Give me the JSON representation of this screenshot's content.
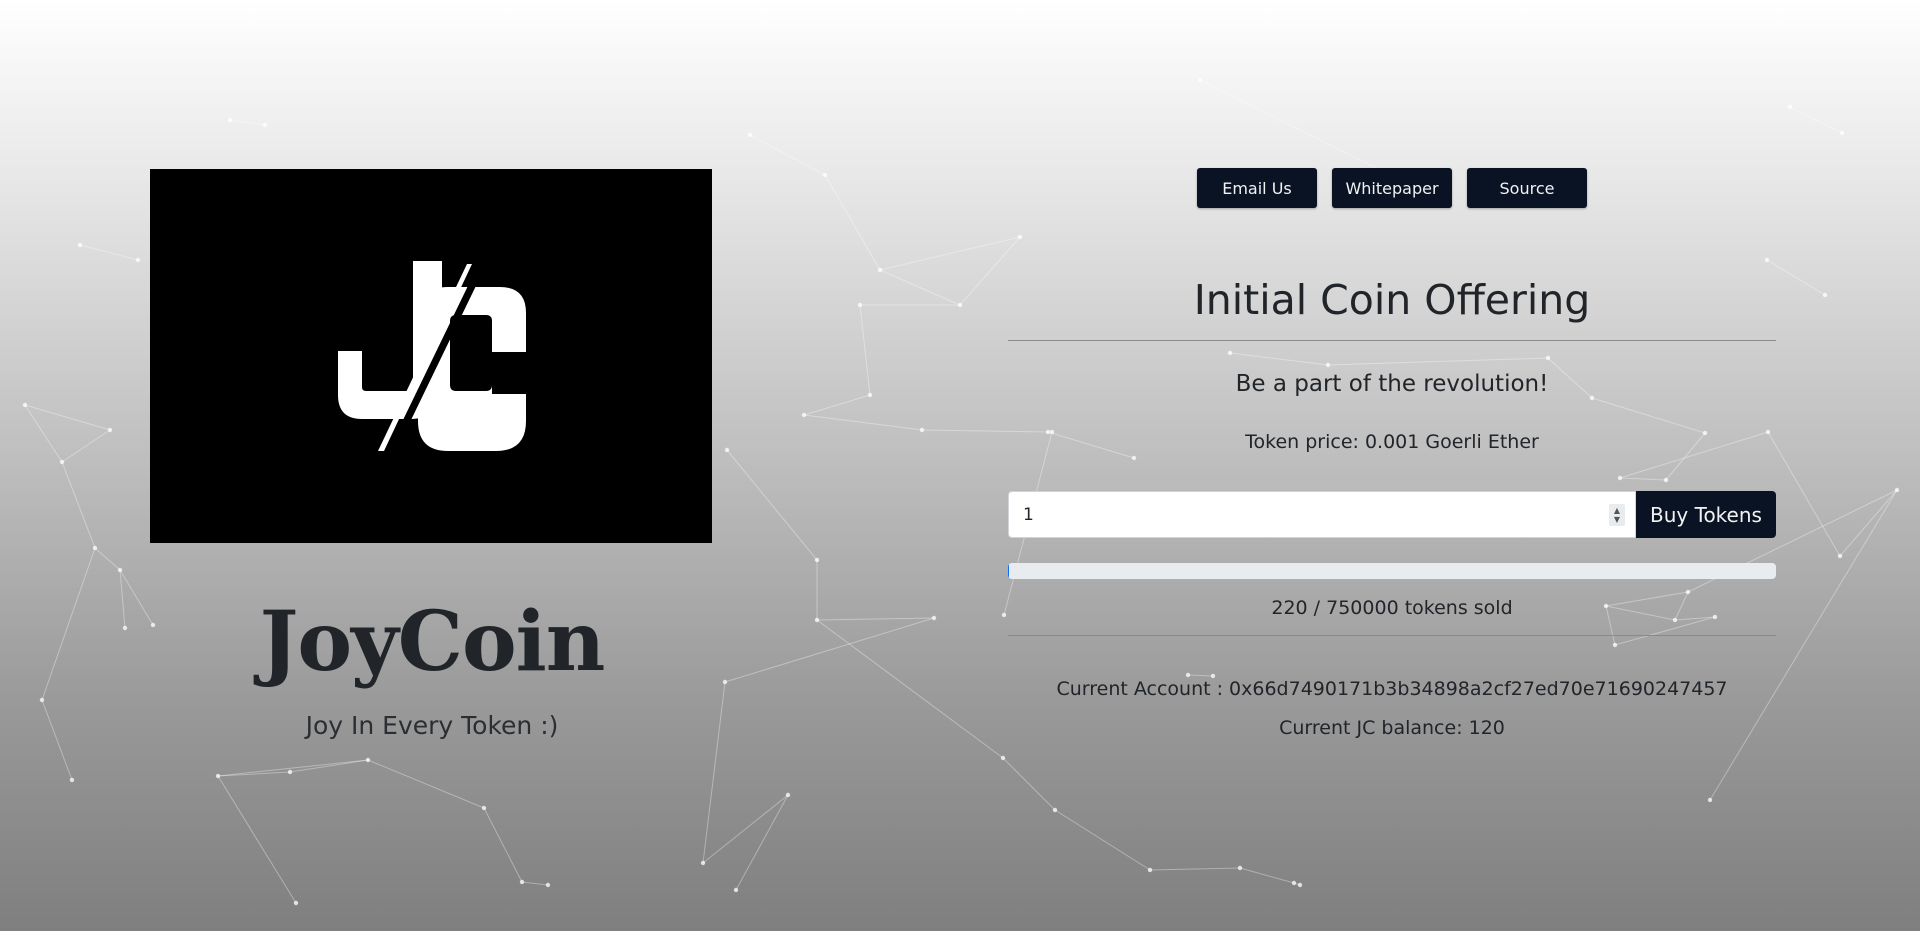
{
  "brand": {
    "title": "JoyCoin",
    "tagline": "Joy In Every Token :)",
    "logo_text": "JC"
  },
  "nav": {
    "email_label": "Email Us",
    "whitepaper_label": "Whitepaper",
    "source_label": "Source"
  },
  "ico": {
    "title": "Initial Coin Offering",
    "subtitle": "Be a part of the revolution!",
    "price_text": "Token price: 0.001 Goerli Ether",
    "quantity_value": "1",
    "buy_label": "Buy Tokens",
    "tokens_sold": 220,
    "tokens_total": 750000,
    "sold_text": "220 / 750000 tokens sold"
  },
  "account": {
    "address_text": "Current Account : 0x66d7490171b3b34898a2cf27ed70e71690247457",
    "balance_text": "Current JC balance: 120"
  },
  "colors": {
    "button_bg": "#0a1323",
    "logo_bg": "#000000",
    "text": "#212529"
  }
}
